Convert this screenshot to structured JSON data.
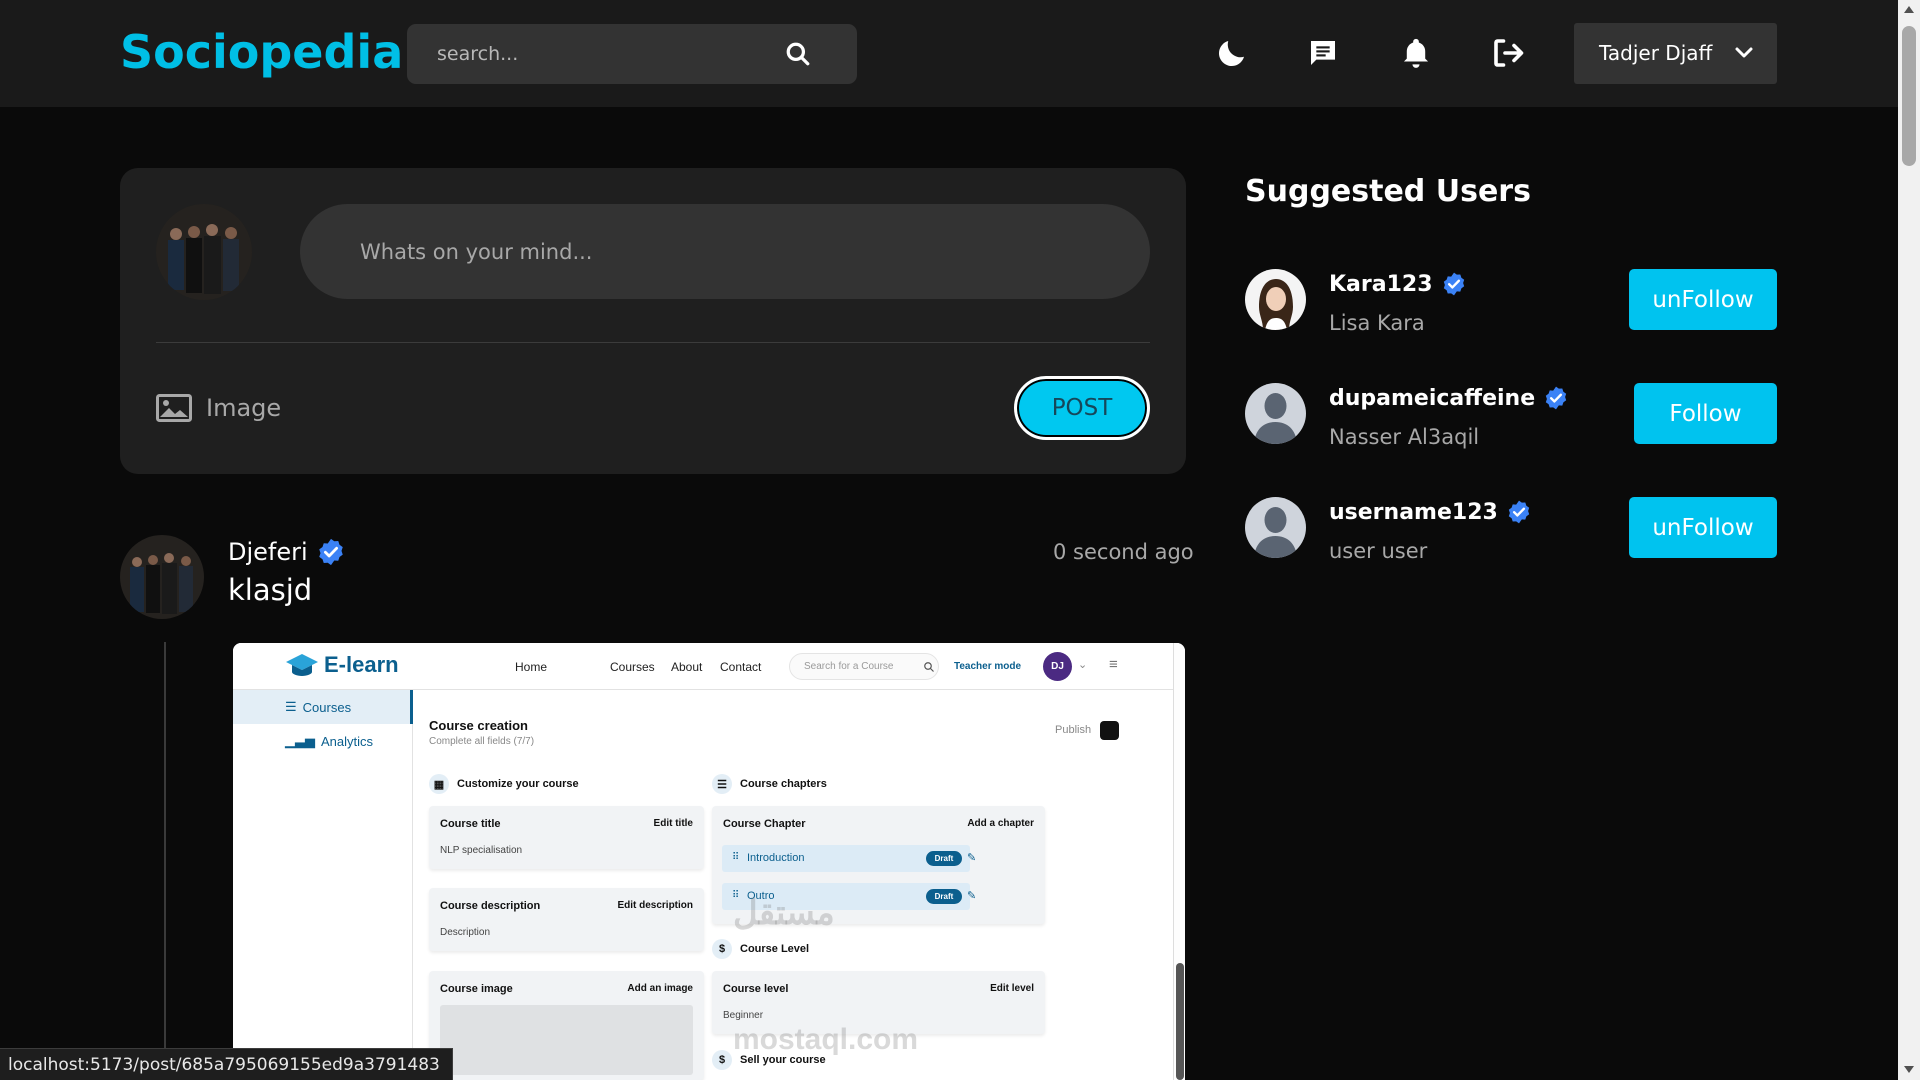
{
  "navbar": {
    "logo": "Sociopedia",
    "search_placeholder": "search...",
    "user_name": "Tadjer Djaff",
    "icons": [
      "moon-icon",
      "message-icon",
      "bell-icon",
      "logout-icon"
    ]
  },
  "create_post": {
    "placeholder": "Whats on your mind...",
    "image_label": "Image",
    "post_button": "POST"
  },
  "post": {
    "author": "Djeferi",
    "verified": true,
    "time": "0 second ago",
    "text": "klasjd",
    "screenshot": {
      "logo": "E-learn",
      "nav": [
        "Home",
        "Courses",
        "About",
        "Contact"
      ],
      "search_placeholder": "Search for a Course",
      "teacher_mode": "Teacher mode",
      "avatar_initials": "DJ",
      "sidebar": [
        "Courses",
        "Analytics"
      ],
      "title": "Course creation",
      "subtitle": "Complete all fields (7/7)",
      "publish": "Publish",
      "customize_heading": "Customize your course",
      "chapters_heading": "Course chapters",
      "course_title_label": "Course title",
      "course_title_action": "Edit title",
      "course_title_value": "NLP specialisation",
      "course_desc_label": "Course description",
      "course_desc_action": "Edit description",
      "course_desc_value": "Description",
      "course_image_label": "Course image",
      "course_image_action": "Add an image",
      "chapter_label": "Course Chapter",
      "chapter_action": "Add a chapter",
      "chapters": [
        {
          "name": "Introduction",
          "status": "Draft"
        },
        {
          "name": "Outro",
          "status": "Draft"
        }
      ],
      "level_heading": "Course Level",
      "level_label": "Course level",
      "level_action": "Edit level",
      "level_value": "Beginner",
      "sell_heading": "Sell your course",
      "watermark": "مستقل",
      "watermark_url": "mostaql.com"
    }
  },
  "status_url": "localhost:5173/post/685a795069155ed9a3791483",
  "suggested": {
    "title": "Suggested Users",
    "users": [
      {
        "username": "Kara123",
        "name": "Lisa Kara",
        "button": "unFollow"
      },
      {
        "username": "dupameicaffeine",
        "name": "Nasser Al3aqil",
        "button": "Follow"
      },
      {
        "username": "username123",
        "name": "user user",
        "button": "unFollow"
      }
    ]
  },
  "colors": {
    "accent": "#00c3ef",
    "background": "#0a0a0a",
    "surface": "#1f1f1f",
    "verified": "#3b82f6"
  }
}
